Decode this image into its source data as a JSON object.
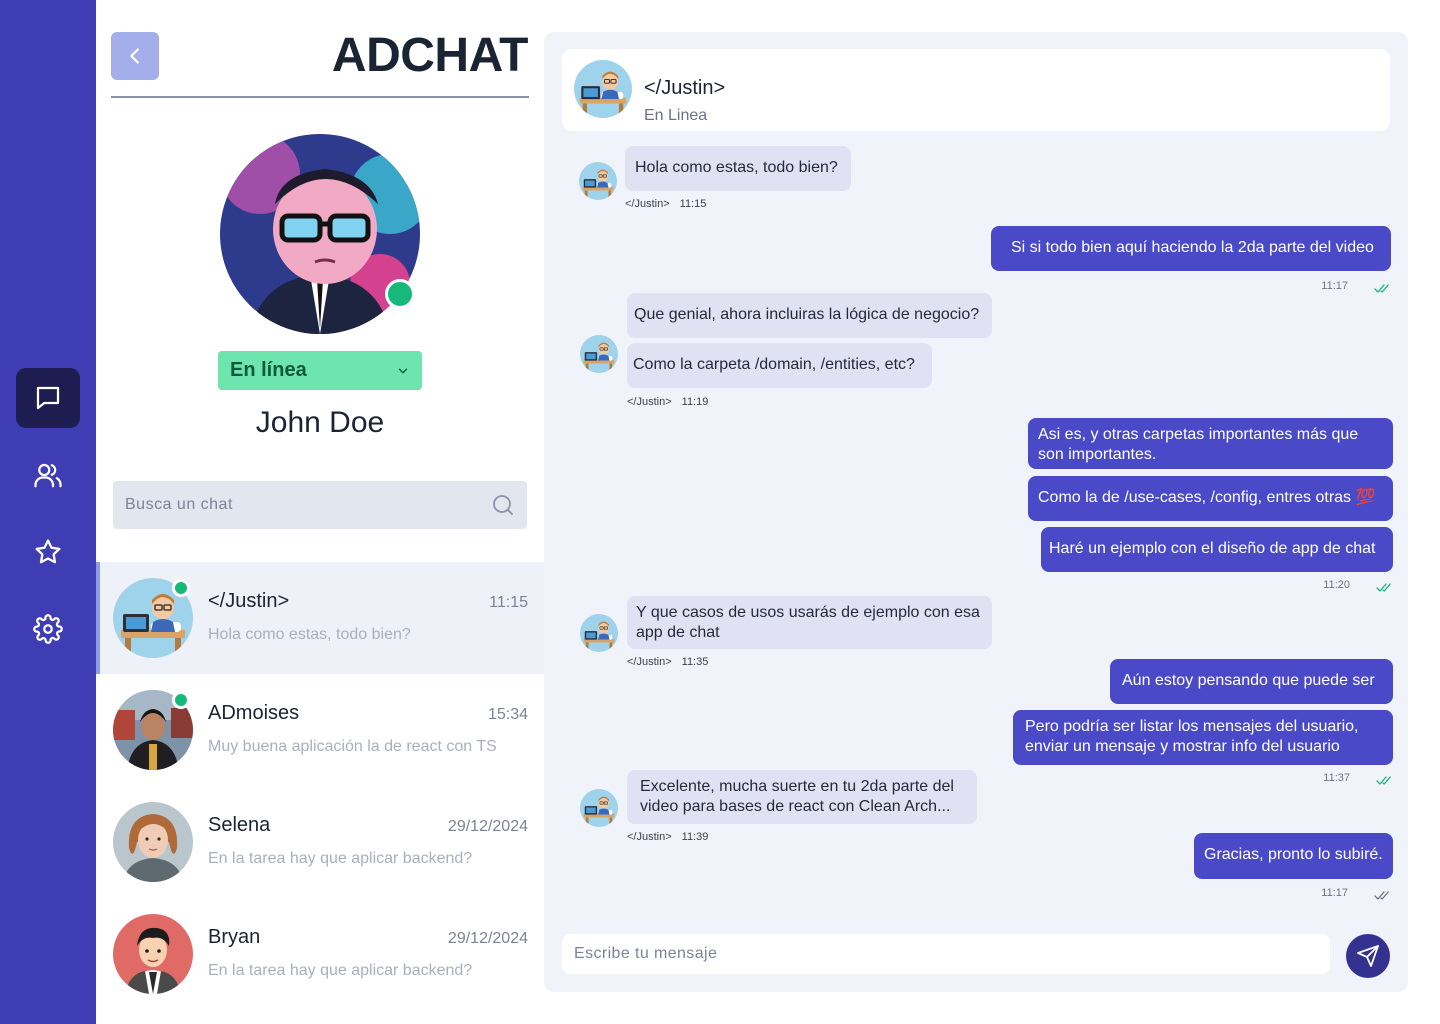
{
  "app": {
    "title": "ADCHAT"
  },
  "nav": {
    "items": [
      {
        "icon": "message-icon",
        "active": true
      },
      {
        "icon": "users-icon",
        "active": false
      },
      {
        "icon": "star-icon",
        "active": false
      },
      {
        "icon": "settings-icon",
        "active": false
      }
    ]
  },
  "profile": {
    "name": "John Doe",
    "status": "En línea",
    "status_color": "#6ee5ae"
  },
  "search": {
    "placeholder": "Busca un chat"
  },
  "chats": [
    {
      "name": "</Justin>",
      "time": "11:15",
      "preview": "Hola como estas, todo bien?",
      "online": true,
      "active": true
    },
    {
      "name": "ADmoises",
      "time": "15:34",
      "preview": "Muy buena aplicación la de react  con TS",
      "online": true,
      "active": false
    },
    {
      "name": "Selena",
      "time": "29/12/2024",
      "preview": "En la tarea hay que aplicar backend?",
      "online": false,
      "active": false
    },
    {
      "name": "Bryan",
      "time": "29/12/2024",
      "preview": "En la tarea hay que aplicar backend?",
      "online": false,
      "active": false
    }
  ],
  "conversation": {
    "contact_name": "</Justin>",
    "contact_status": "En Linea",
    "messages": {
      "m1": {
        "text": "Hola como estas, todo bien?",
        "author": "</Justin>",
        "time": "11:15"
      },
      "m2": {
        "text": "Si si todo bien aquí haciendo la 2da parte del video",
        "time": "11:17"
      },
      "m3a": {
        "text": "Que genial, ahora incluiras la lógica de negocio?"
      },
      "m3b": {
        "text": "Como la carpeta /domain, /entities, etc?",
        "author": "</Justin>",
        "time": "11:19"
      },
      "m4a": {
        "text": "Asi es, y otras carpetas importantes más que son importantes."
      },
      "m4b": {
        "text": "Como la de /use-cases, /config, entres otras 💯"
      },
      "m4c": {
        "text": "Haré un ejemplo con el diseño de app de chat",
        "time": "11:20"
      },
      "m5": {
        "text": "Y que casos de usos usarás de ejemplo con esa app de chat",
        "author": "</Justin>",
        "time": "11:35"
      },
      "m6a": {
        "text": "Aún estoy pensando que puede ser"
      },
      "m6b": {
        "text": "Pero podría ser listar los mensajes del usuario, enviar un mensaje y mostrar info del usuario",
        "time": "11:37"
      },
      "m7": {
        "text": "Excelente, mucha suerte en tu 2da parte del video para bases de react con Clean Arch...",
        "author": "</Justin>",
        "time": "11:39"
      },
      "m8": {
        "text": "Gracias, pronto lo subiré.",
        "time": "11:17"
      }
    },
    "composer_placeholder": "Escribe tu mensaje"
  },
  "colors": {
    "rail": "#3f3db3",
    "accent": "#4a4ac8",
    "online": "#17b87a",
    "incoming_bubble": "#e0e2f4"
  }
}
